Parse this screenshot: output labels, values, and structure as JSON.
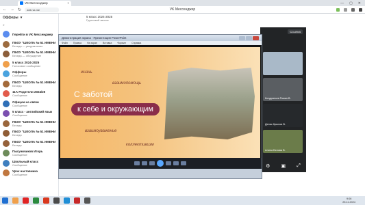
{
  "browser": {
    "tab_title": "VK Мессенджер",
    "tab_close": "×",
    "url": "web.vk.me",
    "page_title": "VK Мессенджер",
    "window_controls": [
      "—",
      "▢",
      "✕"
    ],
    "nav": [
      "←",
      "→",
      "↻"
    ]
  },
  "sidebar": {
    "header": "Офферы",
    "search_icon": "search-icon",
    "chats": [
      {
        "title": "Перейти в VK Мессенджер",
        "snippet": "",
        "color": "#5b8def"
      },
      {
        "title": "ПБОУ \"ШКОЛА № 51 ИМЕНИ СВЕТЛ...",
        "snippet": "Беседа — уведомление",
        "color": "#9c6b3f"
      },
      {
        "title": "ПБОУ \"ШКОЛА № 51 ИМЕНИ СВЕТЛ...",
        "snippet": "Беседа — обсуждение",
        "color": "#8c5e3a"
      },
      {
        "title": "5 класс 2024-2025",
        "snippet": "Голосовое сообщение",
        "color": "#f0a04b"
      },
      {
        "title": "Офферы",
        "snippet": "Сообщение",
        "color": "#4aa3df"
      },
      {
        "title": "ПБОУ \"ШКОЛА № 51 ИМЕНИ СВЕТЛ...",
        "snippet": "Беседа",
        "color": "#a36a3a"
      },
      {
        "title": "11А Родители 2024/25",
        "snippet": "Сообщение",
        "color": "#e25b4b"
      },
      {
        "title": "Офицеи на связи",
        "snippet": "Сообщение",
        "color": "#2f6fb7"
      },
      {
        "title": "5 класс - английский язык",
        "snippet": "Сообщение",
        "color": "#7b4fb0"
      },
      {
        "title": "ПБОУ \"ШКОЛА № 51 ИМЕНИ СВЕТЛ...",
        "snippet": "Беседа",
        "color": "#9a663c"
      },
      {
        "title": "ПБОУ \"ШКОЛА № 51 ИМЕНИ СВЕТЛ...",
        "snippet": "Беседа",
        "color": "#8f5d36"
      },
      {
        "title": "ПБОУ \"ШКОЛА № 51 ИМЕНИ СВЕТЛ...",
        "snippet": "Беседа",
        "color": "#95613a"
      },
      {
        "title": "Пыгуничиков Игорь",
        "snippet": "Сообщение",
        "color": "#6d8b5a"
      },
      {
        "title": "Школьный класс",
        "snippet": "Сообщение",
        "color": "#3f7fbf"
      },
      {
        "title": "Урок наставника",
        "snippet": "Сообщение",
        "color": "#c0773f"
      }
    ]
  },
  "chat_top": {
    "title": "5 класс 2024-2025",
    "subtitle": "Групповой звонок"
  },
  "call": {
    "link_button": "Ссылка",
    "participants": [
      {
        "name": "",
        "color": "#a9b9c8"
      },
      {
        "name": "Кондратьев Роман В.",
        "color": "#5a5e62"
      },
      {
        "name": "Денис Крылов В.",
        "color": "#26292c"
      },
      {
        "name": "Алина Белова В.",
        "color": "#6b7c4a"
      }
    ],
    "controls": [
      "⚙",
      "▣",
      "⤢"
    ]
  },
  "presentation": {
    "window_title": "Демонстрация экрана - Презентация PowerPoint",
    "menu": [
      "Файл",
      "Правка",
      "На экран",
      "Вставка",
      "Формат",
      "Справка"
    ],
    "slide": {
      "title_line1": "С заботой",
      "title_line2": "к себе и окружающим",
      "words": [
        {
          "text": "жизнь"
        },
        {
          "text": "взаимопомощь"
        },
        {
          "text": "взаимоуважение"
        },
        {
          "text": "коллективизм"
        }
      ]
    }
  },
  "os": {
    "time": "9:06",
    "date": "25.11.2024",
    "taskbar_colors": [
      "#1f6fd1",
      "#f0a04b",
      "#e02424",
      "#2b8a3e",
      "#d9381e",
      "#4a4a4a",
      "#1f8ed6",
      "#c62828",
      "#555"
    ]
  }
}
